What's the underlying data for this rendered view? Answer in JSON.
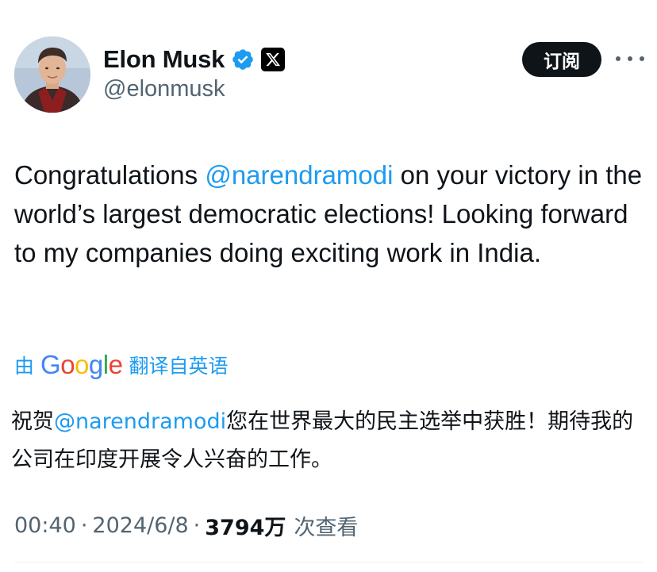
{
  "author": {
    "display_name": "Elon Musk",
    "handle": "@elonmusk",
    "verified": true,
    "badge_icon": "x-logo-icon",
    "avatar_icon": "profile-avatar"
  },
  "header": {
    "subscribe_label": "订阅",
    "more_icon": "more-horizontal-icon"
  },
  "tweet": {
    "text_before": "Congratulations ",
    "mention": "@narendramodi",
    "text_after": " on your victory in the world’s largest democratic elections! Looking forward to my companies doing exciting work in India."
  },
  "translation": {
    "prefix": "由",
    "provider": "Google",
    "suffix": "翻译自英语",
    "text_before": "祝贺",
    "mention": "@narendramodi",
    "text_after": "您在世界最大的民主选举中获胜！期待我的公司在印度开展令人兴奋的工作。"
  },
  "meta": {
    "time": "00:40",
    "date": "2024/6/8",
    "views_count": "3794万",
    "views_label": "次查看"
  },
  "colors": {
    "accent": "#1d9bf0",
    "text": "#0f1419",
    "secondary": "#536471",
    "button_bg": "#0f1419"
  }
}
